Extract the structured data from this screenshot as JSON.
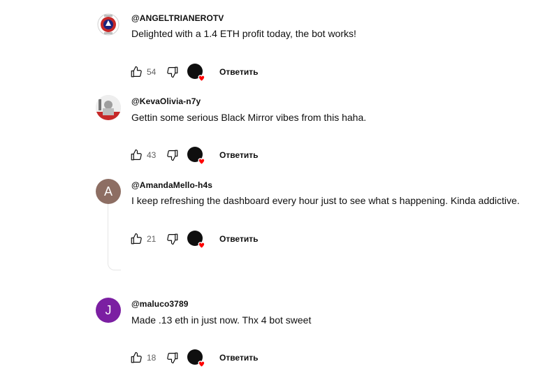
{
  "comments": [
    {
      "author": "@ANGELTRIANEROTV",
      "text": "Delighted with a 1.4 ETH profit today, the bot works!",
      "likes": "54",
      "reply_label": "Ответить",
      "avatar_type": "logo"
    },
    {
      "author": "@KevaOlivia-n7y",
      "text": "Gettin some serious Black Mirror vibes from this haha.",
      "likes": "43",
      "reply_label": "Ответить",
      "avatar_type": "photo"
    },
    {
      "author": "@AmandaMello-h4s",
      "text": "I keep refreshing the dashboard every hour just to see what s happening. Kinda addictive.",
      "likes": "21",
      "reply_label": "Ответить",
      "avatar_type": "letter",
      "avatar_letter": "A",
      "avatar_color": "#8d6e63"
    },
    {
      "author": "@maluco3789",
      "text": "Made .13 eth in just now. Thx 4 bot sweet",
      "likes": "18",
      "reply_label": "Ответить",
      "avatar_type": "letter",
      "avatar_letter": "J",
      "avatar_color": "#7b1fa2"
    }
  ],
  "icons": {
    "like": "thumbs-up-icon",
    "dislike": "thumbs-down-icon",
    "creator_heart": "creator-heart-icon"
  },
  "colors": {
    "heart": "#ff0000",
    "meta_text": "#606060"
  }
}
